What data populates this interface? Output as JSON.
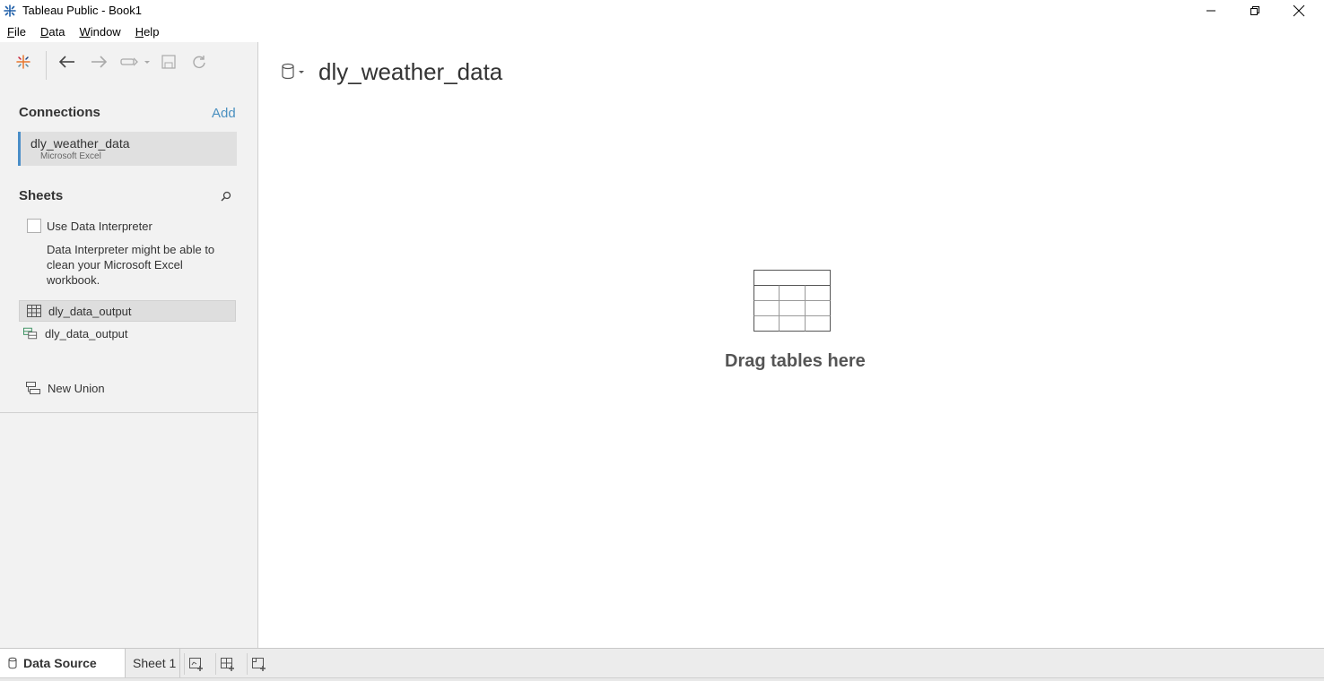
{
  "window": {
    "title": "Tableau Public - Book1",
    "controls": [
      "minimize",
      "restore",
      "close"
    ]
  },
  "menu": {
    "items": [
      {
        "label": "File",
        "mnemonic": "F",
        "rest": "ile"
      },
      {
        "label": "Data",
        "mnemonic": "D",
        "rest": "ata"
      },
      {
        "label": "Window",
        "mnemonic": "W",
        "rest": "indow"
      },
      {
        "label": "Help",
        "mnemonic": "H",
        "rest": "elp"
      }
    ]
  },
  "toolbar": {
    "icons": [
      "tableau-logo-icon",
      "back-icon",
      "forward-icon",
      "redo-icon",
      "save-icon",
      "refresh-icon"
    ]
  },
  "connections": {
    "title": "Connections",
    "add_label": "Add",
    "items": [
      {
        "name": "dly_weather_data",
        "type": "Microsoft Excel"
      }
    ]
  },
  "sheets": {
    "title": "Sheets",
    "use_interpreter_label": "Use Data Interpreter",
    "use_interpreter_checked": false,
    "interpreter_help": "Data Interpreter might be able to clean your Microsoft Excel workbook.",
    "items": [
      {
        "label": "dly_data_output",
        "kind": "sheet",
        "selected": true
      },
      {
        "label": "dly_data_output",
        "kind": "named-range",
        "selected": false
      }
    ],
    "new_union_label": "New Union"
  },
  "canvas": {
    "datasource_title": "dly_weather_data",
    "drop_hint": "Drag tables here"
  },
  "tabs": {
    "items": [
      {
        "label": "Data Source",
        "active": true
      },
      {
        "label": "Sheet 1",
        "active": false
      }
    ],
    "actions": [
      "new-worksheet-icon",
      "new-dashboard-icon",
      "new-story-icon"
    ]
  },
  "colors": {
    "accent": "#4a8ec8",
    "link": "#4a90c0",
    "pane_bg": "#f2f2f2",
    "selected_bg": "#e0e0e0"
  }
}
